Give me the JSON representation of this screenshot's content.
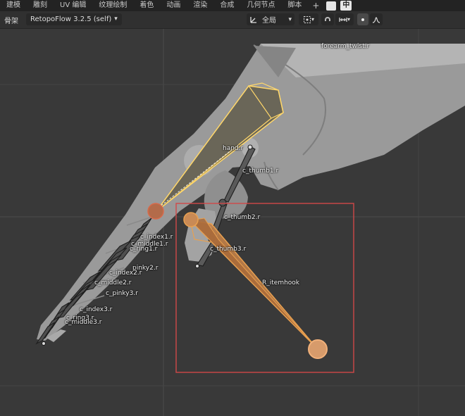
{
  "topbar": {
    "tabs": [
      "建模",
      "雕刻",
      "UV 编辑",
      "纹理绘制",
      "着色",
      "动画",
      "渲染",
      "合成",
      "几何节点",
      "脚本"
    ],
    "plus": "+",
    "lang": "中"
  },
  "header": {
    "mode": "骨架",
    "addon": "RetopoFlow 3.2.5 (self)",
    "transform_orientation": "全局",
    "chevron": "⌄"
  },
  "labels": {
    "forearm": "forearm_twist.r",
    "hand": "hand.r",
    "thumb1": "c_thumb1.r",
    "thumb2": "c_thumb2.r",
    "thumb3": "c_thumb3.r",
    "itemhook": "R_itemhook",
    "index1": "c_index1.r",
    "middle1": "c_middle1.r",
    "ring1": "c_ring1.r",
    "pinky2": "pinky2.r",
    "index2": "c_index2.r",
    "middle2": "c_middle2.r",
    "pinky3": "c_pinky3.r",
    "index3": "c_index3.r",
    "ring3": "c_ring3.r",
    "middle3": "c_middle3.r"
  },
  "colors": {
    "selected_bone": "#e8a050",
    "active_outline": "#ffd76a",
    "selection_box": "#d04848",
    "mesh": "#9a9a9a"
  }
}
